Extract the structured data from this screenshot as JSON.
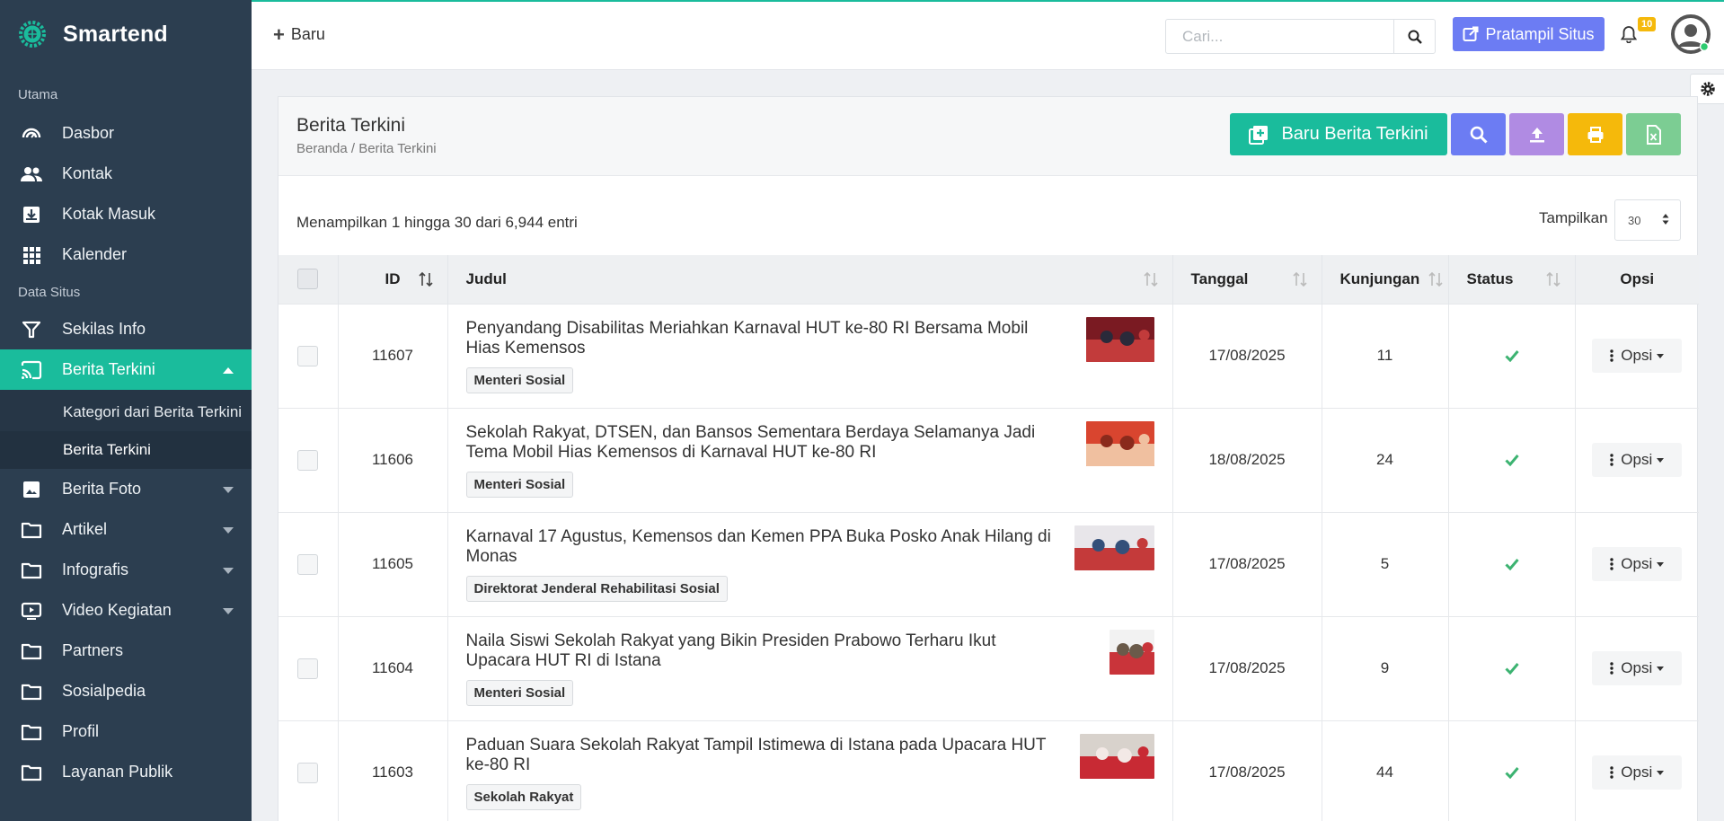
{
  "sidebar": {
    "brand": "Smartend",
    "sections": [
      {
        "label": "Utama",
        "items": [
          {
            "label": "Dasbor",
            "icon": "dashboard-icon"
          },
          {
            "label": "Kontak",
            "icon": "people-icon"
          },
          {
            "label": "Kotak Masuk",
            "icon": "inbox-icon"
          },
          {
            "label": "Kalender",
            "icon": "grid-icon"
          }
        ]
      },
      {
        "label": "Data Situs",
        "items": [
          {
            "label": "Sekilas Info",
            "icon": "filter-icon"
          },
          {
            "label": "Berita Terkini",
            "icon": "cast-icon",
            "active": true
          },
          {
            "label": "Berita Foto",
            "icon": "image-icon"
          },
          {
            "label": "Artikel",
            "icon": "folder-icon"
          },
          {
            "label": "Infografis",
            "icon": "folder-icon"
          },
          {
            "label": "Video Kegiatan",
            "icon": "video-icon"
          },
          {
            "label": "Partners",
            "icon": "folder-icon"
          },
          {
            "label": "Sosialpedia",
            "icon": "folder-icon"
          },
          {
            "label": "Profil",
            "icon": "folder-icon"
          },
          {
            "label": "Layanan Publik",
            "icon": "folder-icon"
          }
        ]
      }
    ],
    "submenu": [
      "Kategori dari Berita Terkini",
      "Berita Terkini"
    ]
  },
  "topbar": {
    "new_label": "Baru",
    "search_placeholder": "Cari...",
    "preview_label": "Pratampil Situs",
    "notification_count": "10"
  },
  "page": {
    "title": "Berita Terkini",
    "breadcrumb": "Beranda / Berita Terkini",
    "add_button": "Baru Berita Terkini",
    "showing": "Menampilkan 1 hingga 30 dari 6,944 entri",
    "per_page_label": "Tampilkan",
    "per_page_value": "30"
  },
  "table": {
    "columns": [
      "ID",
      "Judul",
      "Tanggal",
      "Kunjungan",
      "Status",
      "Opsi"
    ],
    "action_label": "Opsi",
    "rows": [
      {
        "id": "11607",
        "title": "Penyandang Disabilitas Meriahkan Karnaval HUT ke-80 RI Bersama Mobil Hias Kemensos",
        "tag": "Menteri Sosial",
        "date": "17/08/2025",
        "visits": "11",
        "status": "active",
        "thumb_colors": [
          "#7a1a22",
          "#c23b3b",
          "#2a2a3a"
        ]
      },
      {
        "id": "11606",
        "title": "Sekolah Rakyat, DTSEN, dan Bansos Sementara Berdaya Selamanya Jadi Tema Mobil Hias Kemensos di Karnaval HUT ke-80 RI",
        "tag": "Menteri Sosial",
        "date": "18/08/2025",
        "visits": "24",
        "status": "active",
        "thumb_colors": [
          "#d9452f",
          "#f0c0a0",
          "#8a2a1c"
        ]
      },
      {
        "id": "11605",
        "title": "Karnaval 17 Agustus, Kemensos dan Kemen PPA Buka Posko Anak Hilang di Monas",
        "tag": "Direktorat Jenderal Rehabilitasi Sosial",
        "date": "17/08/2025",
        "visits": "5",
        "status": "active",
        "thumb_colors": [
          "#e8e6ea",
          "#c43a3a",
          "#34507a"
        ]
      },
      {
        "id": "11604",
        "title": "Naila Siswi Sekolah Rakyat yang Bikin Presiden Prabowo Terharu Ikut Upacara HUT RI di Istana",
        "tag": "Menteri Sosial",
        "date": "17/08/2025",
        "visits": "9",
        "status": "active",
        "thumb_colors": [
          "#f2f2f2",
          "#c9343a",
          "#6a5a4a"
        ]
      },
      {
        "id": "11603",
        "title": "Paduan Suara Sekolah Rakyat Tampil Istimewa di Istana pada Upacara HUT ke-80 RI",
        "tag": "Sekolah Rakyat",
        "date": "17/08/2025",
        "visits": "44",
        "status": "active",
        "thumb_colors": [
          "#d8d2cc",
          "#c82a34",
          "#f3e9e6"
        ]
      }
    ]
  },
  "colors": {
    "sidebar_bg": "#2c3e50",
    "accent": "#1abc9c",
    "primary": "#6c7cf3",
    "purple": "#b08be3",
    "warning": "#f5b90b",
    "excel": "#7ccd93",
    "status_ok": "#3cb371"
  }
}
